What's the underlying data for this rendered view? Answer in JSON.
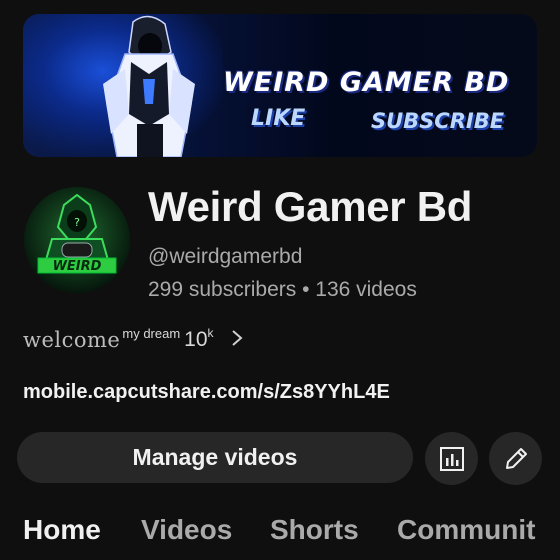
{
  "banner": {
    "title": "WEIRD GAMER BD",
    "like": "LIKE",
    "subscribe": "SUBSCRIBE"
  },
  "avatar": {
    "logo_text": "WEIRD",
    "accent_color": "#2ecc40"
  },
  "channel": {
    "name": "Weird Gamer Bd",
    "handle": "@weirdgamerbd",
    "stats": "299 subscribers • 136 videos"
  },
  "description": {
    "part1": "welcome",
    "part2": "my dream",
    "part3": "10",
    "part4": "k"
  },
  "link": "mobile.capcutshare.com/s/Zs8YYhL4E",
  "actions": {
    "manage_label": "Manage videos",
    "analytics_icon": "analytics-icon",
    "edit_icon": "pencil-icon"
  },
  "tabs": [
    {
      "label": "Home",
      "active": true
    },
    {
      "label": "Videos",
      "active": false
    },
    {
      "label": "Shorts",
      "active": false
    },
    {
      "label": "Communit",
      "active": false
    }
  ]
}
